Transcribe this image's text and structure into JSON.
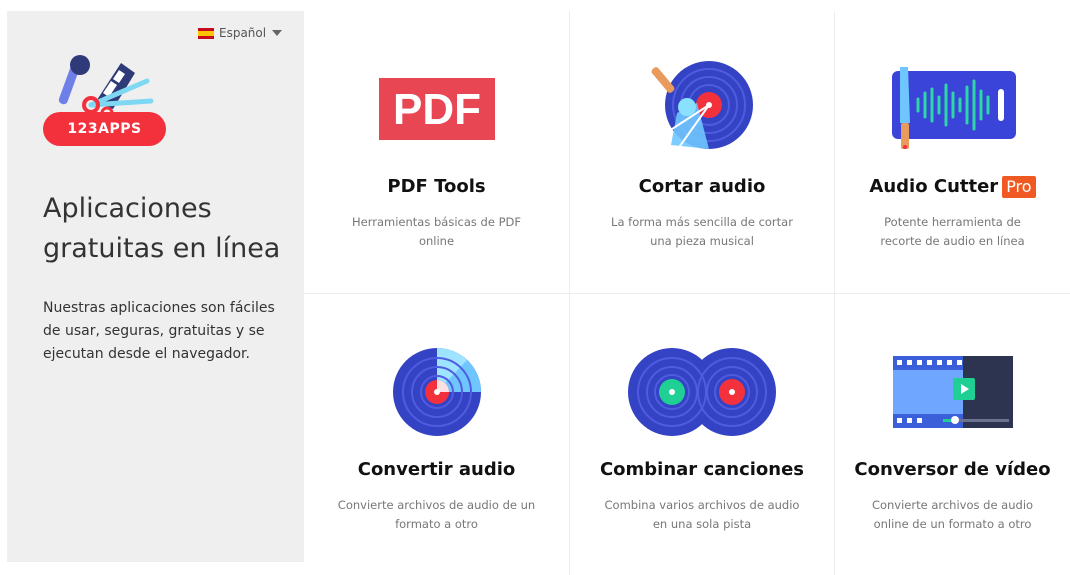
{
  "language": {
    "label": "Español",
    "flag_icon": "spain-flag-icon",
    "caret_icon": "caret-down-icon"
  },
  "brand": {
    "logo_text": "123APPS",
    "accent": "#f2313d"
  },
  "sidebar": {
    "title": "Aplicaciones gratuitas en línea",
    "description": "Nuestras aplicaciones son fáciles de usar, seguras, gratuitas y se ejecutan desde el navegador."
  },
  "apps": [
    {
      "title": "PDF Tools",
      "description": "Herramientas básicas de PDF online",
      "icon": "pdf-icon"
    },
    {
      "title": "Cortar audio",
      "description": "La forma más sencilla de cortar una pieza musical",
      "icon": "vinyl-cut-icon"
    },
    {
      "title": "Audio Cutter",
      "badge": "Pro",
      "description": "Potente herramienta de recorte de audio en línea",
      "icon": "audio-waveform-knife-icon"
    },
    {
      "title": "Convertir audio",
      "description": "Convierte archivos de audio de un formato a otro",
      "icon": "audio-convert-disc-icon"
    },
    {
      "title": "Combinar canciones",
      "description": "Combina varios archivos de audio en una sola pista",
      "icon": "merge-vinyls-icon"
    },
    {
      "title": "Conversor de vídeo",
      "description": "Convierte archivos de audio online de un formato a otro",
      "icon": "video-film-icon"
    }
  ],
  "pdf_icon_text": "PDF"
}
